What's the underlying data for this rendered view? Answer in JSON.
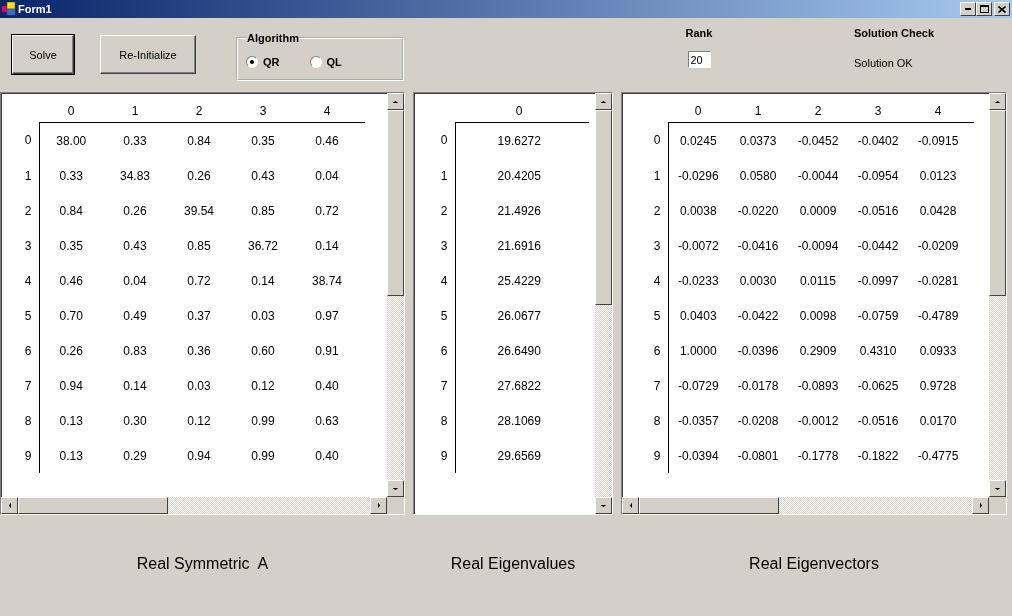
{
  "window": {
    "title": "Form1"
  },
  "buttons": [
    {
      "label": "Solve",
      "default": true
    },
    {
      "label": "Re-Initialize",
      "default": false
    }
  ],
  "algorithm": {
    "title": "Algorithm",
    "options": [
      {
        "label": "QR",
        "selected": true
      },
      {
        "label": "QL",
        "selected": false
      }
    ]
  },
  "rank": {
    "label": "Rank",
    "value": "20"
  },
  "solution_check": {
    "label": "Solution Check",
    "value": "Solution OK"
  },
  "panels": [
    {
      "caption": "Real Symmetric  A",
      "horizontal_scrollbar": true,
      "columns": [
        "0",
        "1",
        "2",
        "3",
        "4"
      ],
      "rows": [
        {
          "label": "0",
          "cells": [
            "38.00",
            "0.33",
            "0.84",
            "0.35",
            "0.46"
          ]
        },
        {
          "label": "1",
          "cells": [
            "0.33",
            "34.83",
            "0.26",
            "0.43",
            "0.04"
          ]
        },
        {
          "label": "2",
          "cells": [
            "0.84",
            "0.26",
            "39.54",
            "0.85",
            "0.72"
          ]
        },
        {
          "label": "3",
          "cells": [
            "0.35",
            "0.43",
            "0.85",
            "36.72",
            "0.14"
          ]
        },
        {
          "label": "4",
          "cells": [
            "0.46",
            "0.04",
            "0.72",
            "0.14",
            "38.74"
          ]
        },
        {
          "label": "5",
          "cells": [
            "0.70",
            "0.49",
            "0.37",
            "0.03",
            "0.97"
          ]
        },
        {
          "label": "6",
          "cells": [
            "0.26",
            "0.83",
            "0.36",
            "0.60",
            "0.91"
          ]
        },
        {
          "label": "7",
          "cells": [
            "0.94",
            "0.14",
            "0.03",
            "0.12",
            "0.40"
          ]
        },
        {
          "label": "8",
          "cells": [
            "0.13",
            "0.30",
            "0.12",
            "0.99",
            "0.63"
          ]
        },
        {
          "label": "9",
          "cells": [
            "0.13",
            "0.29",
            "0.94",
            "0.99",
            "0.40"
          ]
        }
      ]
    },
    {
      "caption": "Real Eigenvalues",
      "horizontal_scrollbar": false,
      "columns": [
        "0"
      ],
      "rows": [
        {
          "label": "0",
          "cells": [
            "19.6272"
          ]
        },
        {
          "label": "1",
          "cells": [
            "20.4205"
          ]
        },
        {
          "label": "2",
          "cells": [
            "21.4926"
          ]
        },
        {
          "label": "3",
          "cells": [
            "21.6916"
          ]
        },
        {
          "label": "4",
          "cells": [
            "25.4229"
          ]
        },
        {
          "label": "5",
          "cells": [
            "26.0677"
          ]
        },
        {
          "label": "6",
          "cells": [
            "26.6490"
          ]
        },
        {
          "label": "7",
          "cells": [
            "27.6822"
          ]
        },
        {
          "label": "8",
          "cells": [
            "28.1069"
          ]
        },
        {
          "label": "9",
          "cells": [
            "29.6569"
          ]
        }
      ]
    },
    {
      "caption": "Real Eigenvectors",
      "horizontal_scrollbar": true,
      "columns": [
        "0",
        "1",
        "2",
        "3",
        "4"
      ],
      "rows": [
        {
          "label": "0",
          "cells": [
            "0.0245",
            "0.0373",
            "-0.0452",
            "-0.0402",
            "-0.0915"
          ]
        },
        {
          "label": "1",
          "cells": [
            "-0.0296",
            "0.0580",
            "-0.0044",
            "-0.0954",
            "0.0123"
          ]
        },
        {
          "label": "2",
          "cells": [
            "0.0038",
            "-0.0220",
            "0.0009",
            "-0.0516",
            "0.0428"
          ]
        },
        {
          "label": "3",
          "cells": [
            "-0.0072",
            "-0.0416",
            "-0.0094",
            "-0.0442",
            "-0.0209"
          ]
        },
        {
          "label": "4",
          "cells": [
            "-0.0233",
            "0.0030",
            "0.0115",
            "-0.0997",
            "-0.0281"
          ]
        },
        {
          "label": "5",
          "cells": [
            "0.0403",
            "-0.0422",
            "0.0098",
            "-0.0759",
            "-0.4789"
          ]
        },
        {
          "label": "6",
          "cells": [
            "1.0000",
            "-0.0396",
            "0.2909",
            "0.4310",
            "0.0933"
          ]
        },
        {
          "label": "7",
          "cells": [
            "-0.0729",
            "-0.0178",
            "-0.0893",
            "-0.0625",
            "0.9728"
          ]
        },
        {
          "label": "8",
          "cells": [
            "-0.0357",
            "-0.0208",
            "-0.0012",
            "-0.0516",
            "0.0170"
          ]
        },
        {
          "label": "9",
          "cells": [
            "-0.0394",
            "-0.0801",
            "-0.1778",
            "-0.1822",
            "-0.4775"
          ]
        }
      ]
    }
  ]
}
